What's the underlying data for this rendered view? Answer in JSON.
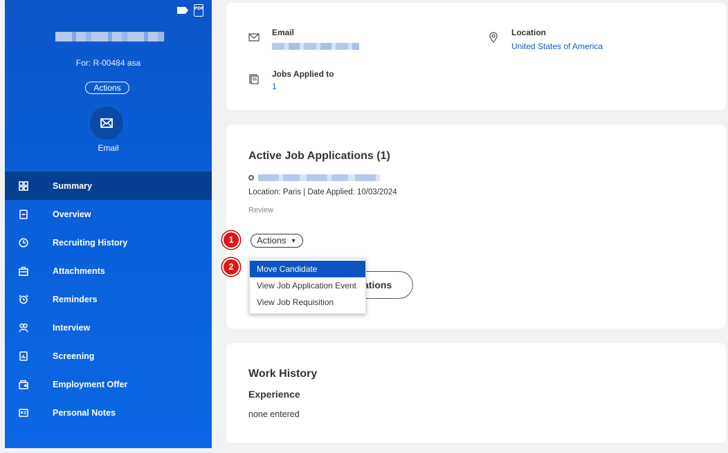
{
  "sidebar": {
    "for_line": "For: R-00484 asa",
    "actions_label": "Actions",
    "email_label": "Email",
    "nav": [
      {
        "label": "Summary",
        "icon": "grid-icon",
        "active": true
      },
      {
        "label": "Overview",
        "icon": "document-icon",
        "active": false
      },
      {
        "label": "Recruiting History",
        "icon": "clock-icon",
        "active": false
      },
      {
        "label": "Attachments",
        "icon": "briefcase-icon",
        "active": false
      },
      {
        "label": "Reminders",
        "icon": "alarm-icon",
        "active": false
      },
      {
        "label": "Interview",
        "icon": "people-icon",
        "active": false
      },
      {
        "label": "Screening",
        "icon": "clipboard-chart-icon",
        "active": false
      },
      {
        "label": "Employment Offer",
        "icon": "wallet-icon",
        "active": false
      },
      {
        "label": "Personal Notes",
        "icon": "id-card-icon",
        "active": false
      }
    ],
    "pdf_label": "PDF"
  },
  "contact": {
    "email_label": "Email",
    "location_label": "Location",
    "location_value": "United States of America",
    "jobs_label": "Jobs Applied to",
    "jobs_value": "1"
  },
  "applications": {
    "title": "Active Job Applications (1)",
    "meta": "Location: Paris | Date Applied: 10/03/2024",
    "status": "Review",
    "actions_label": "Actions",
    "button_partial": "ations",
    "menu": [
      "Move Candidate",
      "View Job Application Event",
      "View Job Requisition"
    ]
  },
  "work": {
    "title": "Work History",
    "subtitle": "Experience",
    "value": "none entered"
  },
  "badges": [
    "1",
    "2"
  ],
  "colors": {
    "sidebar": "#0b5fd8",
    "active_nav": "#063f8f",
    "link": "#0f5bc9",
    "badge": "#e01515"
  }
}
